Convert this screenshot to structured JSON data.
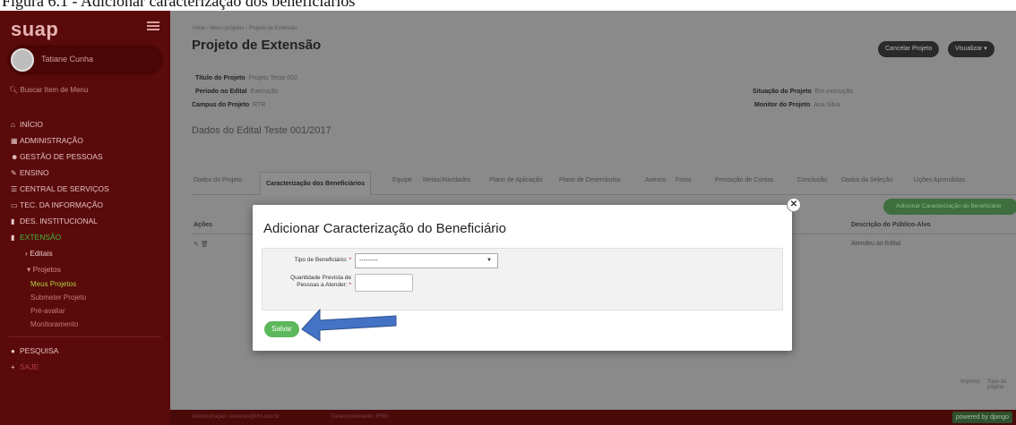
{
  "caption": "Figura 6.1 - Adicionar caracterização dos beneficiários",
  "colors": {
    "sidebar": "#5a0a0a",
    "accent_green": "#5cb85c",
    "arrow_blue": "#4472c4"
  },
  "sidebar": {
    "logo": "suap",
    "user_name": "Tatiane Cunha",
    "search_placeholder": "Buscar Item de Menu",
    "items": [
      {
        "icon": "home-icon",
        "label": "INÍCIO"
      },
      {
        "icon": "grid-icon",
        "label": "ADMINISTRAÇÃO"
      },
      {
        "icon": "people-icon",
        "label": "GESTÃO DE PESSOAS"
      },
      {
        "icon": "pencil-icon",
        "label": "ENSINO"
      },
      {
        "icon": "list-icon",
        "label": "CENTRAL DE SERVIÇOS"
      },
      {
        "icon": "monitor-icon",
        "label": "TEC. DA INFORMAÇÃO"
      },
      {
        "icon": "chart-icon",
        "label": "DES. INSTITUCIONAL"
      },
      {
        "icon": "chart-icon",
        "label": "EXTENSÃO"
      }
    ],
    "sub_editais": "Editais",
    "sub_projetos": "Projetos",
    "sub_projects": [
      "Meus Projetos",
      "Submeter Projeto",
      "Pré-avaliar",
      "Monitoramento"
    ],
    "pesquisa": "PESQUISA",
    "saje": "SAJE"
  },
  "main": {
    "breadcrumb": "Início › Meus projetos › Projeto de Extensão",
    "title": "Projeto de Extensão",
    "cancel_button": "Cancelar Projeto",
    "view_button": "Visualizar ▾",
    "fields": {
      "titulo_label": "Título do Projeto",
      "titulo_value": "Projeto Teste 002",
      "periodo_label": "Período no Edital",
      "periodo_value": "Execução",
      "campus_label": "Campus do Projeto",
      "campus_value": "RTR",
      "situacao_label": "Situação do Projeto",
      "situacao_value": "Em execução",
      "monitor_label": "Monitor do Projeto",
      "monitor_value": "Ana Silva"
    },
    "edital_heading": "Dados do Edital Teste 001/2017",
    "tabs": [
      "Dados do Projeto",
      "Caracterização dos Beneficiários",
      "Equipe",
      "Metas/Atividades",
      "Plano de Aplicação",
      "Plano de Desembolso",
      "Anexos",
      "Fotos",
      "Prestação de Contas",
      "Conclusão",
      "Dados da Seleção",
      "Lições Aprendidas"
    ],
    "add_button": "Adicionar Caracterização do Beneficiário",
    "table_headers": {
      "acoes": "Ações",
      "descricao": "Descrição do Público-Alvo"
    },
    "table_row": {
      "descricao": "Atendeu ao Edital"
    },
    "bottom_links": {
      "left": "Imprimir",
      "right": "Topo da página"
    },
    "footer": {
      "admin": "Administração: sistemas@ifrn.edu.br",
      "dev": "Desenvolvimento: IFRN",
      "django": "powered by django"
    }
  },
  "modal": {
    "title": "Adicionar Caracterização do Beneficiário",
    "close": "✕",
    "tipo_label": "Tipo de Beneficiário:",
    "tipo_value": "---------",
    "quantidade_label_1": "Quantidade Prevista de",
    "quantidade_label_2": "Pessoas a Atender:",
    "required_mark": "*",
    "save_button": "Salvar"
  }
}
